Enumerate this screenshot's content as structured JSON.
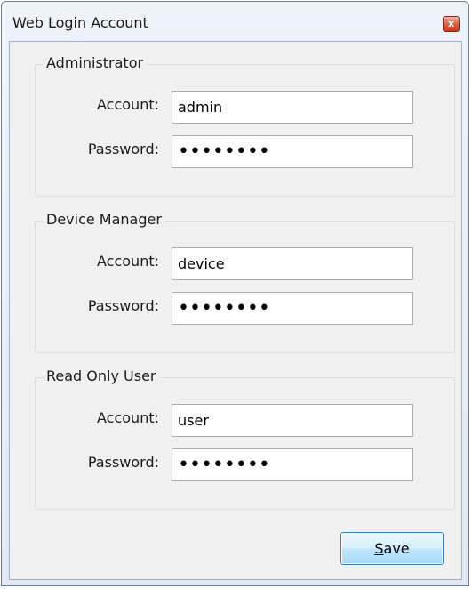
{
  "window": {
    "title": "Web Login Account",
    "close_glyph": "x"
  },
  "groups": [
    {
      "title": "Administrator",
      "account_label": "Account:",
      "account_value": "admin",
      "password_label": "Password:",
      "password_value": "••••••••"
    },
    {
      "title": "Device Manager",
      "account_label": "Account:",
      "account_value": "device",
      "password_label": "Password:",
      "password_value": "••••••••"
    },
    {
      "title": "Read Only User",
      "account_label": "Account:",
      "account_value": "user",
      "password_label": "Password:",
      "password_value": "••••••••"
    }
  ],
  "buttons": {
    "save_mnemonic": "S",
    "save_rest": "ave"
  },
  "colors": {
    "close_button": "#d95b3d",
    "save_button_border": "#3c7fb1"
  }
}
